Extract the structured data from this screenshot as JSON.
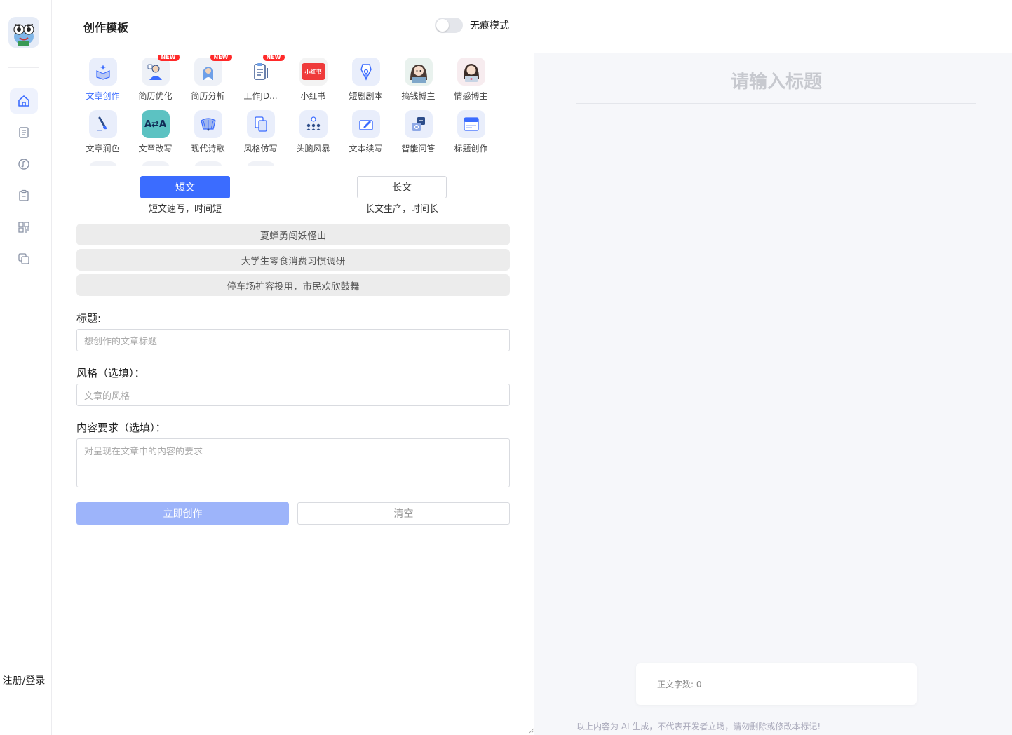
{
  "sidebar": {
    "nav_icons": [
      "home-icon",
      "document-icon",
      "music-icon",
      "clipboard-icon",
      "grid-icon",
      "copy-icon"
    ],
    "login_label": "注册/登录"
  },
  "panel": {
    "title": "创作模板",
    "incognito_label": "无痕模式",
    "incognito_on": false,
    "templates": [
      {
        "label": "文章创作",
        "icon": "box-sparkle-icon",
        "active": true,
        "badge": ""
      },
      {
        "label": "简历优化",
        "icon": "resume-person-icon",
        "active": false,
        "badge": "NEW"
      },
      {
        "label": "简历分析",
        "icon": "resume-analysis-icon",
        "active": false,
        "badge": "NEW"
      },
      {
        "label": "工作JD...",
        "icon": "clipboard-jd-icon",
        "active": false,
        "badge": "NEW"
      },
      {
        "label": "小红书",
        "icon": "xiaohongshu-icon",
        "active": false,
        "badge": "",
        "icon_text": "小红书"
      },
      {
        "label": "短剧剧本",
        "icon": "pen-nib-icon",
        "active": false,
        "badge": ""
      },
      {
        "label": "搞钱博主",
        "icon": "avatar-girl-icon",
        "active": false,
        "badge": ""
      },
      {
        "label": "情感博主",
        "icon": "avatar-laptop-girl-icon",
        "active": false,
        "badge": ""
      },
      {
        "label": "文章润色",
        "icon": "brush-icon",
        "active": false,
        "badge": ""
      },
      {
        "label": "文章改写",
        "icon": "translate-icon",
        "active": false,
        "badge": "",
        "icon_text": "A⇄A"
      },
      {
        "label": "现代诗歌",
        "icon": "fan-icon",
        "active": false,
        "badge": ""
      },
      {
        "label": "风格仿写",
        "icon": "copy-docs-icon",
        "active": false,
        "badge": ""
      },
      {
        "label": "头脑风暴",
        "icon": "brainstorm-people-icon",
        "active": false,
        "badge": ""
      },
      {
        "label": "文本续写",
        "icon": "edit-box-icon",
        "active": false,
        "badge": ""
      },
      {
        "label": "智能问答",
        "icon": "qa-cards-icon",
        "active": false,
        "badge": ""
      },
      {
        "label": "标题创作",
        "icon": "title-card-icon",
        "active": false,
        "badge": ""
      }
    ],
    "modes": {
      "short_label": "短文",
      "short_desc": "短文速写，时间短",
      "long_label": "长文",
      "long_desc": "长文生产，时间长"
    },
    "samples": [
      "夏蝉勇闯妖怪山",
      "大学生零食消费习惯调研",
      "停车场扩容投用，市民欢欣鼓舞"
    ],
    "form": {
      "title_label": "标题:",
      "title_placeholder": "想创作的文章标题",
      "style_label": "风格（选填）：",
      "style_placeholder": "文章的风格",
      "content_label": "内容要求（选填）：",
      "content_placeholder": "对呈现在文章中的内容的要求"
    },
    "create_label": "立即创作",
    "clear_label": "清空"
  },
  "editor": {
    "title_placeholder": "请输入标题",
    "wordcount_label": "正文字数: 0",
    "disclaimer": "以上内容为 AI 生成，不代表开发者立场，请勿删除或修改本标记!"
  },
  "colors": {
    "accent": "#3b6cff",
    "accent_disabled": "#9db4fa",
    "badge": "#ff2a2a",
    "editor_bg": "#f6f7fa"
  }
}
